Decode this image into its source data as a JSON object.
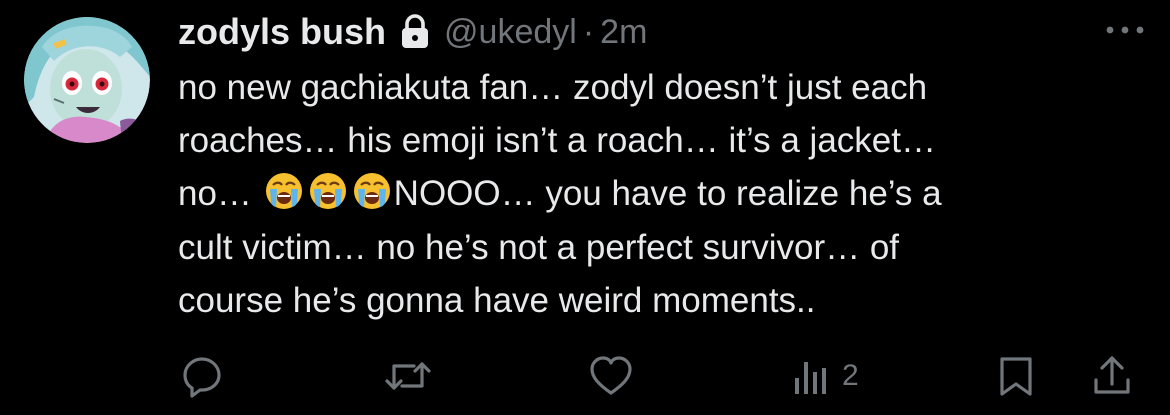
{
  "author": {
    "display_name": "zodyls bush",
    "handle": "@ukedyl",
    "separator": "·",
    "timestamp": "2m",
    "locked": true
  },
  "tweet": {
    "lines": [
      "no new gachiakuta fan… zodyl doesn’t just each",
      "roaches… his emoji isn’t a roach… it’s a jacket…",
      "no…",
      "NOOO… you have to realize he’s a",
      "cult victim… no he’s not a perfect survivor… of",
      "course he’s gonna have weird moments.."
    ],
    "emoji": [
      "loudly-crying-face",
      "loudly-crying-face",
      "loudly-crying-face"
    ]
  },
  "actions": {
    "views_count": "2"
  },
  "icons": {
    "more": "more-horizontal-icon",
    "lock": "lock-icon",
    "reply": "reply-icon",
    "repost": "repost-icon",
    "like": "heart-icon",
    "views": "views-icon",
    "bookmark": "bookmark-icon",
    "share": "share-icon"
  },
  "colors": {
    "background": "#000000",
    "primary_text": "#e7e9ea",
    "secondary_text": "#71767b"
  }
}
